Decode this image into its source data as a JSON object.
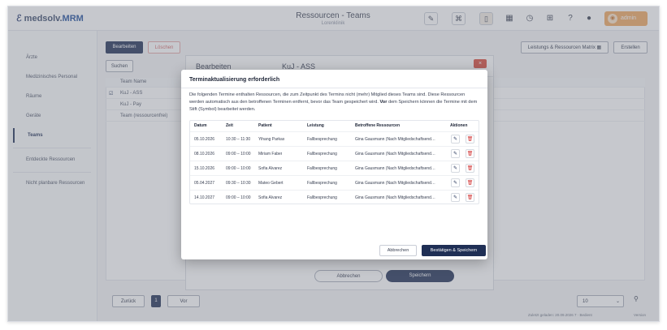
{
  "app": {
    "logo_text": "medsolv.",
    "logo_brand": "MRM",
    "title": "Ressourcen - Teams",
    "subtitle": "Lorenklinik",
    "user_label": "admin"
  },
  "sidebar": {
    "items": [
      {
        "label": "Ärzte"
      },
      {
        "label": "Medizinisches Personal"
      },
      {
        "label": "Räume"
      },
      {
        "label": "Geräte"
      },
      {
        "label": "Teams"
      },
      {
        "label": "Entdeckte Ressourcen"
      },
      {
        "label": "Nicht planbare Ressourcen"
      }
    ]
  },
  "toolbar": {
    "edit_label": "Bearbeiten",
    "delete_label": "Löschen",
    "search_label": "Suchen",
    "matrix_label": "Leistungs & Ressourcen Matrix",
    "create_label": "Erstellen"
  },
  "background_table": {
    "header": "Team Name",
    "rows": [
      "KuJ - ASS",
      "KuJ - Pay",
      "Team (ressourcenfrei)"
    ]
  },
  "editor": {
    "title": "Bearbeiten",
    "team": "KuJ - ASS",
    "cancel_label": "Abbrechen",
    "save_label": "Speichern"
  },
  "pagination": {
    "prev": "Zurück",
    "page": "1",
    "next": "Vor",
    "per_page": "10"
  },
  "footer": {
    "status": "Zuletzt geladen: 20.09.2026 7 · Bedient",
    "version": "Version"
  },
  "modal": {
    "title": "Terminaktualisierung erforderlich",
    "description": "Die folgenden Termine enthalten Ressourcen, die zum Zeitpunkt des Termins nicht (mehr) Mitglied dieses Teams sind. Diese Ressourcen werden automatisch aus den betroffenen Terminen entfernt, bevor das Team gespeichert wird.",
    "description_bold": "Vor",
    "description_tail": "dem Speichern können die Termine mit dem Stift (Symbol) bearbeitet werden.",
    "columns": [
      "Datum",
      "Zeit",
      "Patient",
      "Leistung",
      "Betroffene Ressourcen",
      "Aktionen"
    ],
    "rows": [
      {
        "date": "05.10.2026",
        "time": "10:30 – 11:30",
        "patient": "Yihang Parkas",
        "service": "Fallbesprechung",
        "resource": "Gina Gausmann (Nach Mitgliedschaftsend…"
      },
      {
        "date": "08.10.2026",
        "time": "09:00 – 10:00",
        "patient": "Miriam Faber",
        "service": "Fallbesprechung",
        "resource": "Gina Gausmann (Nach Mitgliedschaftsend…"
      },
      {
        "date": "15.10.2026",
        "time": "09:00 – 10:00",
        "patient": "Sofia Alvarez",
        "service": "Fallbesprechung",
        "resource": "Gina Gausmann (Nach Mitgliedschaftsend…"
      },
      {
        "date": "05.04.2027",
        "time": "09:30 – 10:30",
        "patient": "Mateo Gebert",
        "service": "Fallbesprechung",
        "resource": "Gina Gausmann (Nach Mitgliedschaftsend…"
      },
      {
        "date": "14.10.2027",
        "time": "09:00 – 10:00",
        "patient": "Sofia Alvarez",
        "service": "Fallbesprechung",
        "resource": "Gina Gausmann (Nach Mitgliedschaftsend…"
      }
    ],
    "cancel_label": "Abbrechen",
    "confirm_label": "Bestätigen & Speichern"
  },
  "icons": {
    "edit": "pencil-icon",
    "delete": "trash-icon"
  }
}
